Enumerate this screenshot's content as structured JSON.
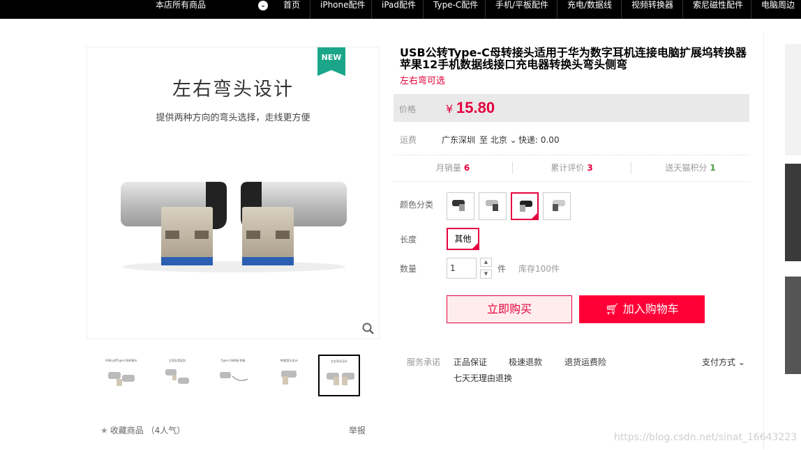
{
  "nav": {
    "all_label": "本店所有商品",
    "items": [
      "首页",
      "iPhone配件",
      "iPad配件",
      "Type-C配件",
      "手机/平板配件",
      "充电/数据线",
      "视频转换器",
      "索尼磁性配件",
      "电脑周边"
    ]
  },
  "gallery": {
    "title": "左右弯头设计",
    "subtitle": "提供两种方向的弯头选择，走线更方便",
    "badge": "NEW",
    "thumbs": [
      "USB公转Type-C母转接头",
      "左弯右弯区别",
      "Type-C母转接 转接",
      "90度弯头设计",
      "左右弯头设计"
    ]
  },
  "product": {
    "title": "USB公转Type-C母转接头适用于华为数字耳机连接电脑扩展坞转换器苹果12手机数据线接口充电器转换头弯头侧弯",
    "subtitle": "左右弯可选",
    "price_label": "价格",
    "currency": "¥",
    "price": "15.80",
    "ship_label": "运费",
    "ship_from": "广东深圳",
    "ship_to": "至 北京",
    "ship_fee": "快递: 0.00",
    "stats": {
      "sales_label": "月销量",
      "sales": "6",
      "reviews_label": "累计评价",
      "reviews": "3",
      "points_label": "送天猫积分",
      "points": "1"
    },
    "color_label": "颜色分类",
    "length_label": "长度",
    "length_option": "其他",
    "qty_label": "数量",
    "qty": "1",
    "qty_unit": "件",
    "stock": "库存100件",
    "buy_now": "立即购买",
    "add_cart": "加入购物车",
    "service_label": "服务承诺",
    "services": [
      "正品保证",
      "极速退款",
      "退货运费险",
      "七天无理由退换"
    ],
    "pay_label": "支付方式"
  },
  "footer": {
    "fav_label": "收藏商品",
    "fav_count": "（4人气）",
    "report": "举报"
  },
  "watermark": "https://blog.csdn.net/sinat_16643223",
  "colors": {
    "accent": "#e4003f",
    "cart": "#ff0036",
    "badge": "#1ba68a"
  }
}
